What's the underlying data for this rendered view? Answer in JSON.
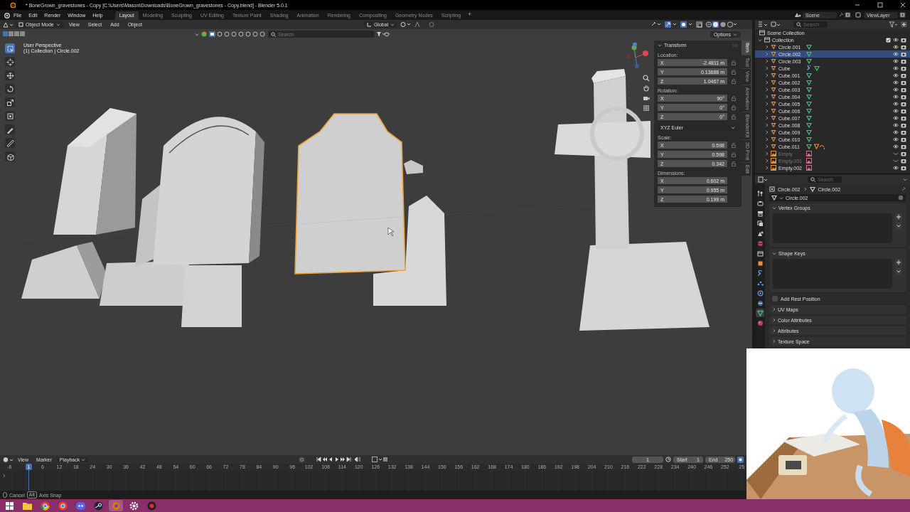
{
  "window": {
    "title": "* BoneGrown_gravestones - Copy [C:\\Users\\Mason\\Downloads\\BoneGrown_gravestones - Copy.blend] - Blender 5.0.1"
  },
  "menubar": {
    "menus": [
      "File",
      "Edit",
      "Render",
      "Window",
      "Help"
    ],
    "workspaces": [
      {
        "label": "Layout",
        "selected": true
      },
      {
        "label": "Modeling",
        "selected": false
      },
      {
        "label": "Sculpting",
        "selected": false
      },
      {
        "label": "UV Editing",
        "selected": false
      },
      {
        "label": "Texture Paint",
        "selected": false
      },
      {
        "label": "Shading",
        "selected": false
      },
      {
        "label": "Animation",
        "selected": false
      },
      {
        "label": "Rendering",
        "selected": false
      },
      {
        "label": "Compositing",
        "selected": false
      },
      {
        "label": "Geometry Nodes",
        "selected": false
      },
      {
        "label": "Scripting",
        "selected": false
      }
    ],
    "add_workspace": "+",
    "scene": "Scene",
    "view_layer": "ViewLayer"
  },
  "viewport": {
    "mode": "Object Mode",
    "menus": [
      "View",
      "Select",
      "Add",
      "Object"
    ],
    "orientation": "Global",
    "search_placeholder": "Search",
    "options": "Options",
    "view_name": "User Perspective",
    "collection_info": "(1) Collection | Circle.002",
    "tools": [
      {
        "kind": "select",
        "selected": true
      },
      {
        "kind": "cursor",
        "selected": false
      },
      {
        "kind": "move",
        "selected": false
      },
      {
        "kind": "rotate",
        "selected": false
      },
      {
        "kind": "scale",
        "selected": false
      },
      {
        "kind": "transform",
        "selected": false
      },
      {
        "kind": "annotate",
        "selected": false
      },
      {
        "kind": "measure",
        "selected": false
      },
      {
        "kind": "add",
        "selected": false
      }
    ],
    "objects": [
      {
        "kind": "block",
        "selected": false
      },
      {
        "kind": "arch",
        "selected": false
      },
      {
        "kind": "back",
        "selected": false
      },
      {
        "kind": "headstone",
        "selected": true
      },
      {
        "kind": "cross",
        "selected": false
      }
    ]
  },
  "sidebar": {
    "title": "Transform",
    "sections": [
      {
        "kind": "fields",
        "label": "Location:",
        "fields": [
          {
            "axis": "X",
            "value": "-2.4811 m",
            "locked": false
          },
          {
            "axis": "Y",
            "value": "0.13688 m",
            "locked": false
          },
          {
            "axis": "Z",
            "value": "1.0467 m",
            "locked": false
          }
        ]
      },
      {
        "kind": "fields",
        "label": "Rotation:",
        "fields": [
          {
            "axis": "X",
            "value": "90°",
            "locked": false
          },
          {
            "axis": "Y",
            "value": "0°",
            "locked": false
          },
          {
            "axis": "Z",
            "value": "0°",
            "locked": false
          }
        ]
      },
      {
        "kind": "dropdown",
        "value": "XYZ Euler"
      },
      {
        "kind": "fields",
        "label": "Scale:",
        "fields": [
          {
            "axis": "X",
            "value": "0.598",
            "locked": false
          },
          {
            "axis": "Y",
            "value": "0.598",
            "locked": false
          },
          {
            "axis": "Z",
            "value": "0.342",
            "locked": false
          }
        ]
      },
      {
        "kind": "fields",
        "label": "Dimensions:",
        "fields": [
          {
            "axis": "X",
            "value": "0.602 m"
          },
          {
            "axis": "Y",
            "value": "0.955 m"
          },
          {
            "axis": "Z",
            "value": "0.199 m"
          }
        ]
      }
    ],
    "tabs": [
      {
        "label": "Item",
        "selected": true
      },
      {
        "label": "Tool",
        "selected": false
      },
      {
        "label": "View",
        "selected": false
      },
      {
        "label": "Animation",
        "selected": false
      },
      {
        "label": "BlenderKit",
        "selected": false
      },
      {
        "label": "3D Print",
        "selected": false
      },
      {
        "label": "Edit",
        "selected": false
      }
    ]
  },
  "outliner": {
    "search_placeholder": "Search",
    "root": "Scene Collection",
    "collection": {
      "label": "Collection",
      "expanded": true
    },
    "items": [
      {
        "label": "Circle.001",
        "kind": "mesh",
        "selected": false,
        "hidden": false
      },
      {
        "label": "Circle.002",
        "kind": "mesh",
        "selected": true,
        "hidden": false
      },
      {
        "label": "Circle.003",
        "kind": "mesh",
        "selected": false,
        "hidden": false
      },
      {
        "label": "Cube",
        "kind": "mesh",
        "selected": false,
        "hidden": false,
        "modifier": true
      },
      {
        "label": "Cube.001",
        "kind": "mesh",
        "selected": false,
        "hidden": false
      },
      {
        "label": "Cube.002",
        "kind": "mesh",
        "selected": false,
        "hidden": false
      },
      {
        "label": "Cube.003",
        "kind": "mesh",
        "selected": false,
        "hidden": false
      },
      {
        "label": "Cube.004",
        "kind": "mesh",
        "selected": false,
        "hidden": false
      },
      {
        "label": "Cube.005",
        "kind": "mesh",
        "selected": false,
        "hidden": false
      },
      {
        "label": "Cube.006",
        "kind": "mesh",
        "selected": false,
        "hidden": false
      },
      {
        "label": "Cube.007",
        "kind": "mesh",
        "selected": false,
        "hidden": false
      },
      {
        "label": "Cube.008",
        "kind": "mesh",
        "selected": false,
        "hidden": false
      },
      {
        "label": "Cube.009",
        "kind": "mesh",
        "selected": false,
        "hidden": false
      },
      {
        "label": "Cube.010",
        "kind": "mesh",
        "selected": false,
        "hidden": false
      },
      {
        "label": "Cube.011",
        "kind": "mesh",
        "selected": false,
        "hidden": false,
        "extra": true
      },
      {
        "label": "Empty",
        "kind": "empty",
        "selected": false,
        "hidden": true
      },
      {
        "label": "Empty.001",
        "kind": "empty",
        "selected": false,
        "hidden": true
      },
      {
        "label": "Empty.002",
        "kind": "empty",
        "selected": false,
        "hidden": false
      }
    ]
  },
  "properties": {
    "search_placeholder": "Search",
    "breadcrumb": [
      "Circle.002",
      "Circle.002"
    ],
    "data_name": "Circle.002",
    "tabs": [
      {
        "kind": "tool",
        "selected": false
      },
      {
        "kind": "render",
        "selected": false
      },
      {
        "kind": "output",
        "selected": false
      },
      {
        "kind": "view_layer",
        "selected": false
      },
      {
        "kind": "scene",
        "selected": false
      },
      {
        "kind": "world",
        "selected": false
      },
      {
        "kind": "collection",
        "selected": false
      },
      {
        "kind": "object",
        "selected": false
      },
      {
        "kind": "modifier",
        "selected": false
      },
      {
        "kind": "particles",
        "selected": false
      },
      {
        "kind": "physics",
        "selected": false
      },
      {
        "kind": "constraint",
        "selected": false
      },
      {
        "kind": "data",
        "selected": true
      },
      {
        "kind": "material",
        "selected": false
      }
    ],
    "panels": [
      {
        "kind": "list",
        "title": "Vertex Groups",
        "expanded": true
      },
      {
        "kind": "list",
        "title": "Shape Keys",
        "expanded": true
      },
      {
        "kind": "checkbox",
        "label": "Add Rest Position",
        "checked": false
      },
      {
        "kind": "panel",
        "title": "UV Maps",
        "expanded": false
      },
      {
        "kind": "panel",
        "title": "Color Attributes",
        "expanded": false
      },
      {
        "kind": "panel",
        "title": "Attributes",
        "expanded": false
      },
      {
        "kind": "panel",
        "title": "Texture Space",
        "expanded": false
      }
    ]
  },
  "timeline": {
    "menus": [
      "View",
      "Marker"
    ],
    "playback": "Playback",
    "current_frame": "1",
    "start_label": "Start",
    "start": "1",
    "end_label": "End",
    "end": "250",
    "playhead": "1",
    "ticks": [
      "-6",
      "6",
      "12",
      "18",
      "24",
      "30",
      "36",
      "42",
      "48",
      "54",
      "60",
      "66",
      "72",
      "78",
      "84",
      "90",
      "96",
      "102",
      "108",
      "114",
      "120",
      "126",
      "132",
      "138",
      "144",
      "150",
      "156",
      "162",
      "168",
      "174",
      "180",
      "186",
      "192",
      "198",
      "204",
      "210",
      "216",
      "222",
      "228",
      "234",
      "240",
      "246",
      "252",
      "25"
    ]
  },
  "status": {
    "cancel": "Cancel",
    "key": "Alt",
    "action": "Axis Snap"
  },
  "taskbar": {
    "apps": [
      {
        "kind": "start",
        "selected": false
      },
      {
        "kind": "files",
        "selected": false
      },
      {
        "kind": "chrome",
        "selected": false
      },
      {
        "kind": "browser",
        "selected": false
      },
      {
        "kind": "chat",
        "selected": false
      },
      {
        "kind": "steam",
        "selected": false
      },
      {
        "kind": "blender",
        "selected": true
      },
      {
        "kind": "settings",
        "selected": false
      },
      {
        "kind": "recorder",
        "selected": false
      }
    ]
  }
}
